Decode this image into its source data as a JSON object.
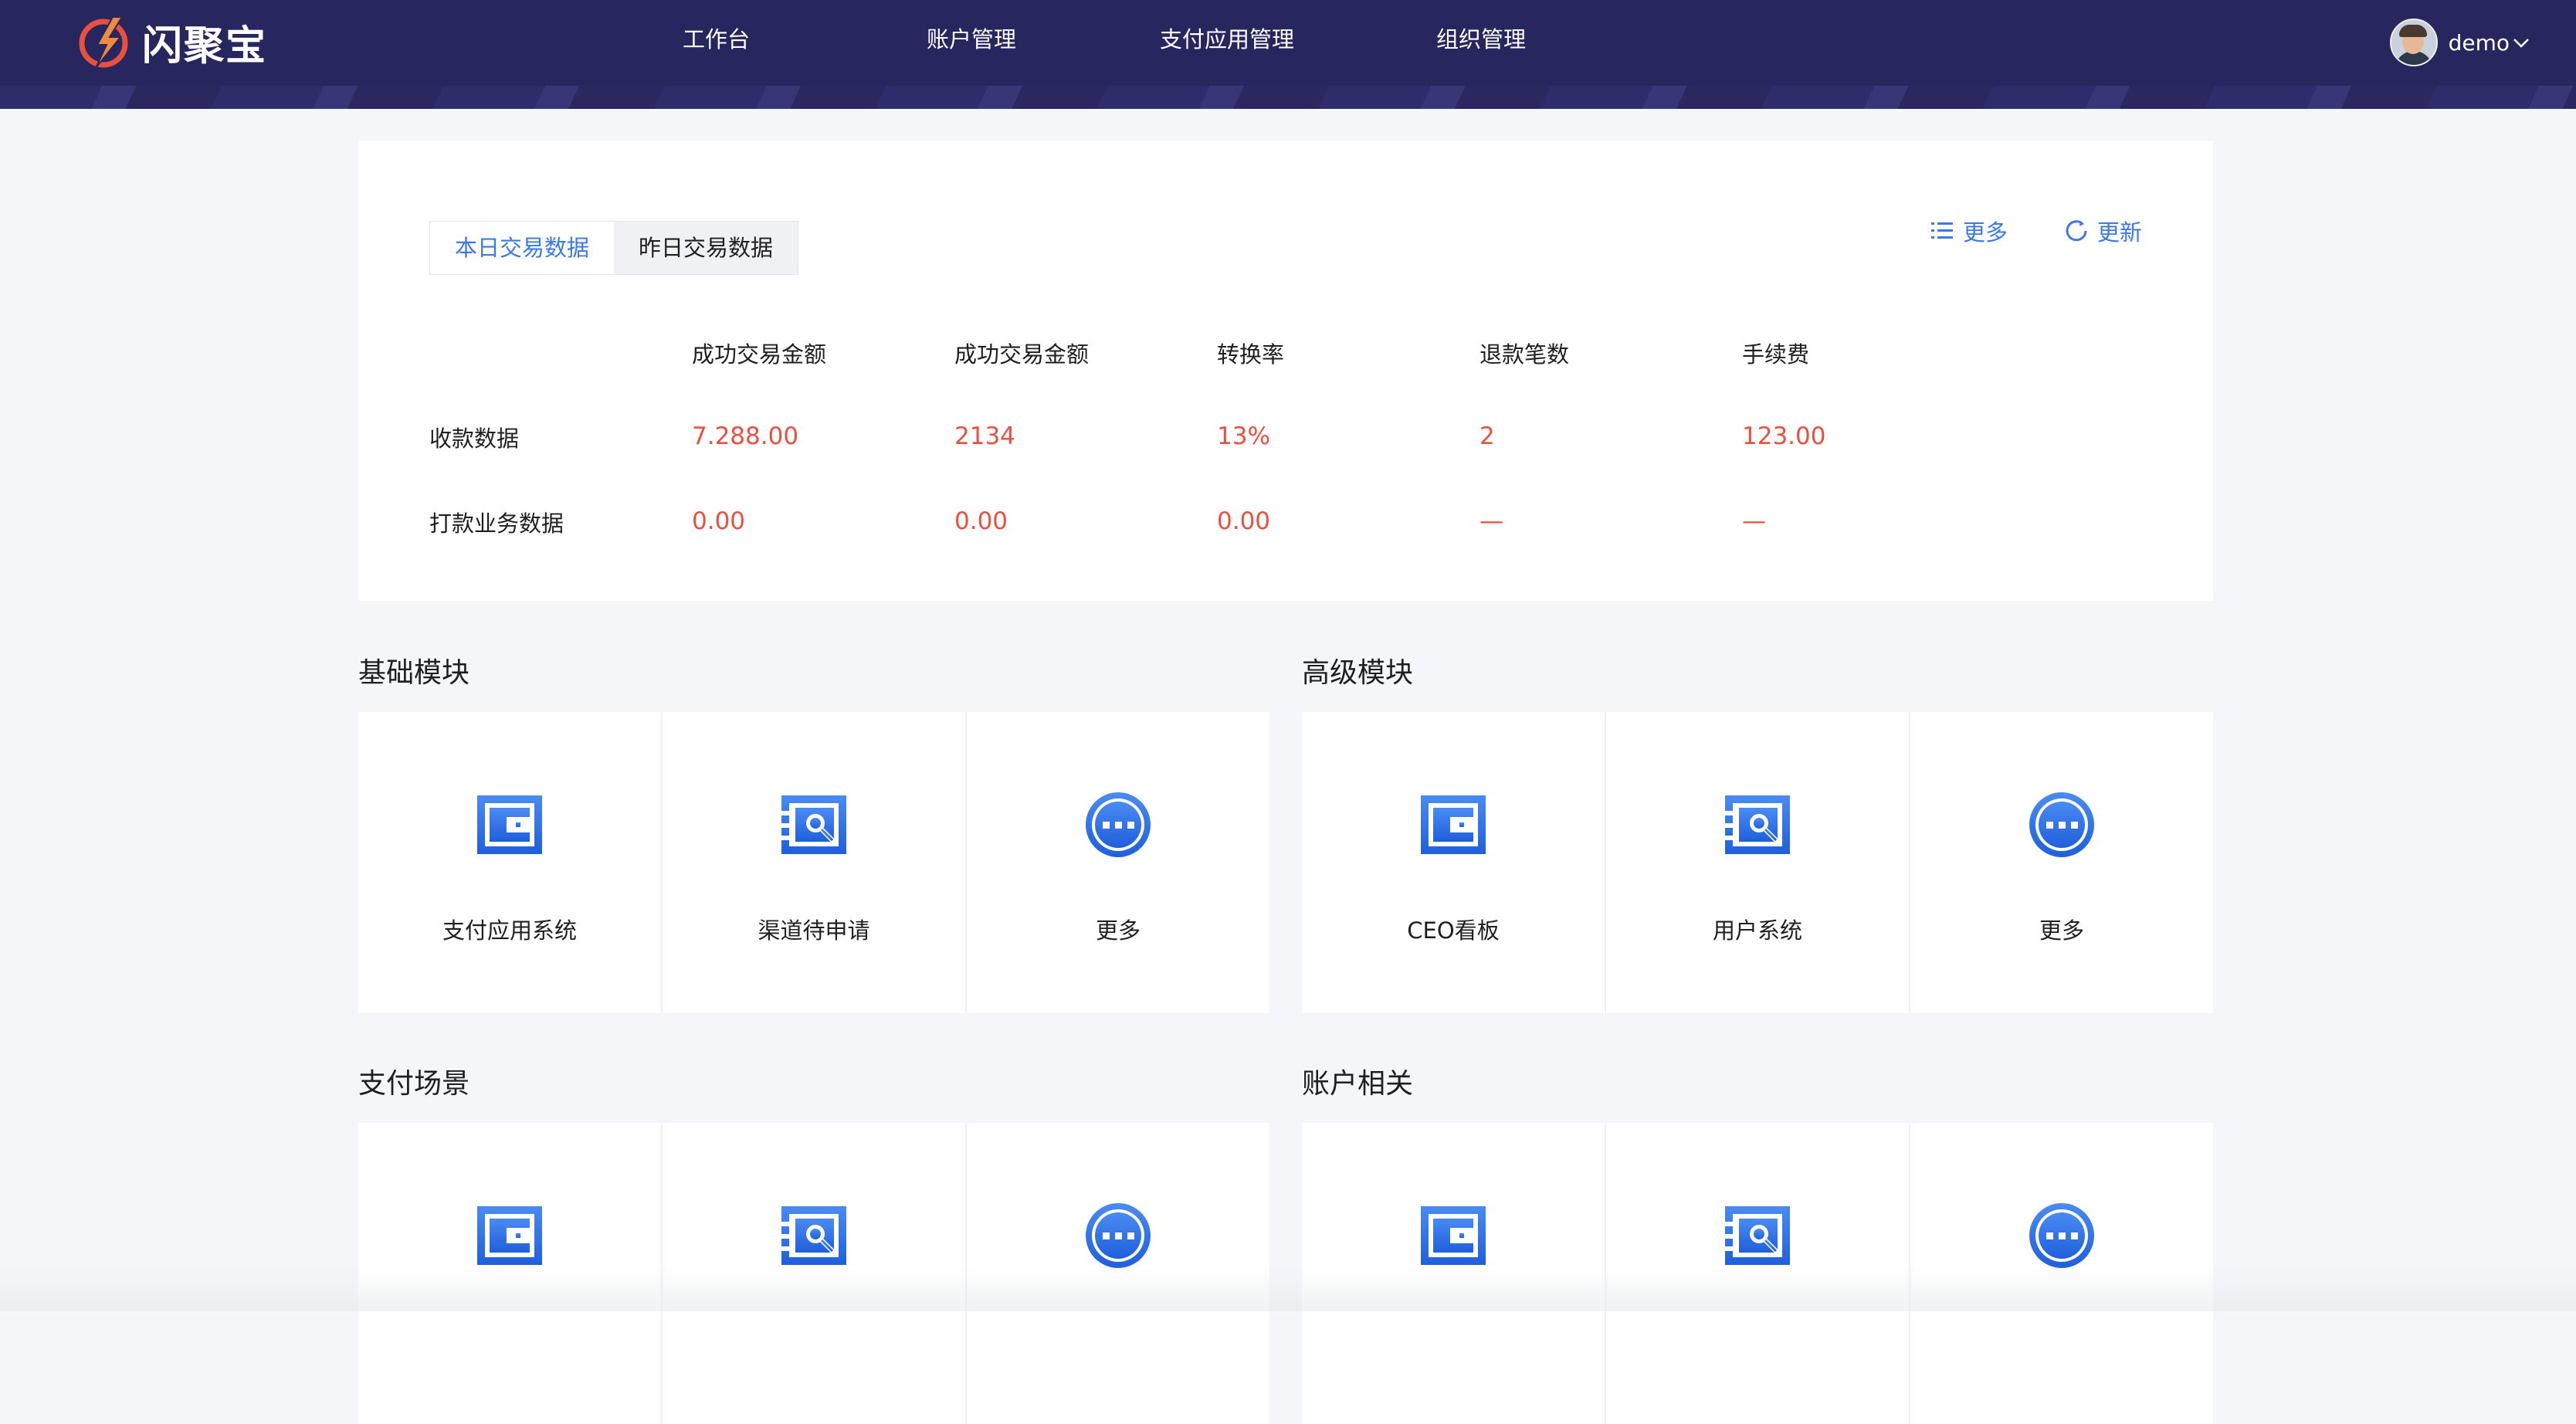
{
  "header": {
    "brand": "闪聚宝",
    "nav": [
      "工作台",
      "账户管理",
      "支付应用管理",
      "组织管理"
    ],
    "user": "demo"
  },
  "stats": {
    "tabs": [
      "本日交易数据",
      "昨日交易数据"
    ],
    "actions": {
      "more": "更多",
      "refresh": "更新"
    },
    "columns": [
      "成功交易金额",
      "成功交易金额",
      "转换率",
      "退款笔数",
      "手续费"
    ],
    "rows": [
      {
        "label": "收款数据",
        "values": [
          "7.288.00",
          "2134",
          "13%",
          "2",
          "123.00"
        ]
      },
      {
        "label": "打款业务数据",
        "values": [
          "0.00",
          "0.00",
          "0.00",
          "—",
          "—"
        ]
      }
    ]
  },
  "sections": [
    {
      "title": "基础模块",
      "tiles": [
        {
          "icon": "wallet-icon",
          "label": "支付应用系统"
        },
        {
          "icon": "search-doc-icon",
          "label": "渠道待申请"
        },
        {
          "icon": "more-icon",
          "label": "更多"
        }
      ]
    },
    {
      "title": "高级模块",
      "tiles": [
        {
          "icon": "wallet-icon",
          "label": "CEO看板"
        },
        {
          "icon": "search-doc-icon",
          "label": "用户系统"
        },
        {
          "icon": "more-icon",
          "label": "更多"
        }
      ]
    },
    {
      "title": "支付场景",
      "tiles": [
        {
          "icon": "wallet-icon",
          "label": ""
        },
        {
          "icon": "search-doc-icon",
          "label": ""
        },
        {
          "icon": "more-icon",
          "label": ""
        }
      ]
    },
    {
      "title": "账户相关",
      "tiles": [
        {
          "icon": "wallet-icon",
          "label": ""
        },
        {
          "icon": "search-doc-icon",
          "label": ""
        },
        {
          "icon": "more-icon",
          "label": ""
        }
      ]
    }
  ],
  "colors": {
    "header": "#28265e",
    "accent": "#3a79e6",
    "value": "#e8503f",
    "icon": "#2e6ee6"
  }
}
